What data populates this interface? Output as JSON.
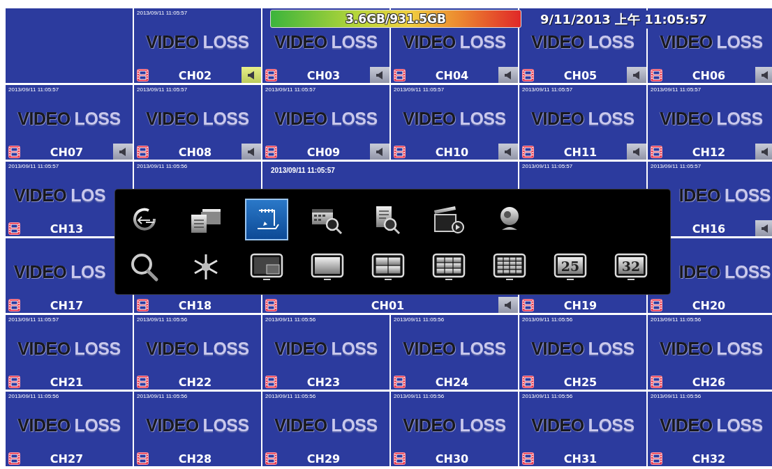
{
  "hdd_usage": {
    "text": "3.6GB/931.5GB"
  },
  "clock": {
    "text": "9/11/2013 上午 11:05:57"
  },
  "cells": [
    {
      "kind": "empty"
    },
    {
      "kind": "channel",
      "timestamp": "2013/09/11 11:05:57",
      "video_loss": [
        "VIDEO",
        "LOSS"
      ],
      "label": "CH02",
      "speaker_highlighted": true
    },
    {
      "kind": "channel",
      "video_loss": [
        "VIDEO",
        "LOSS"
      ],
      "label": "CH03",
      "speaker_highlighted": false
    },
    {
      "kind": "channel",
      "video_loss": [
        "VIDEO",
        "LOSS"
      ],
      "label": "CH04",
      "speaker_highlighted": false
    },
    {
      "kind": "channel",
      "video_loss": [
        "VIDEO",
        "LOSS"
      ],
      "label": "CH05",
      "speaker_highlighted": false
    },
    {
      "kind": "channel",
      "video_loss": [
        "VIDEO",
        "LOSS"
      ],
      "label": "CH06",
      "speaker_highlighted": false
    },
    {
      "kind": "channel",
      "timestamp": "2013/09/11 11:05:57",
      "video_loss": [
        "VIDEO",
        "LOSS"
      ],
      "label": "CH07",
      "speaker_highlighted": false
    },
    {
      "kind": "channel",
      "timestamp": "2013/09/11 11:05:57",
      "video_loss": [
        "VIDEO",
        "LOSS"
      ],
      "label": "CH08",
      "speaker_highlighted": false
    },
    {
      "kind": "channel",
      "timestamp": "2013/09/11 11:05:57",
      "video_loss": [
        "VIDEO",
        "LOSS"
      ],
      "label": "CH09",
      "speaker_highlighted": false
    },
    {
      "kind": "channel",
      "timestamp": "2013/09/11 11:05:57",
      "video_loss": [
        "VIDEO",
        "LOSS"
      ],
      "label": "CH10",
      "speaker_highlighted": false
    },
    {
      "kind": "channel",
      "timestamp": "2013/09/11 11:05:57",
      "video_loss": [
        "VIDEO",
        "LOSS"
      ],
      "label": "CH11",
      "speaker_highlighted": false
    },
    {
      "kind": "channel",
      "timestamp": "2013/09/11 11:05:57",
      "video_loss": [
        "VIDEO",
        "LOSS"
      ],
      "label": "CH12",
      "speaker_highlighted": false
    },
    {
      "kind": "channel",
      "timestamp": "2013/09/11 11:05:57",
      "video_loss": [
        "VIDEO",
        "LOS"
      ],
      "covered_right": true,
      "label": "CH13"
    },
    {
      "kind": "channel",
      "timestamp": "2013/09/11 11:05:56"
    },
    {
      "kind": "main",
      "timestamp": "2013/09/11 11:05:57",
      "label": "CH01",
      "speaker_highlighted": false
    },
    {
      "kind": "channel",
      "timestamp": "2013/09/11 11:05:57"
    },
    {
      "kind": "channel",
      "timestamp": "2013/09/11 11:05:57",
      "video_loss": [
        "IDEO",
        "LOSS"
      ],
      "covered_left": true,
      "label": "CH16",
      "speaker_highlighted": false
    },
    {
      "kind": "channel",
      "video_loss": [
        "VIDEO",
        "LOS"
      ],
      "covered_right": true,
      "label": "CH17"
    },
    {
      "kind": "channel",
      "label": "CH18"
    },
    {
      "kind": "channel",
      "label": "CH19"
    },
    {
      "kind": "channel",
      "video_loss": [
        "IDEO",
        "LOSS"
      ],
      "covered_left": true,
      "label": "CH20"
    },
    {
      "kind": "channel",
      "timestamp": "2013/09/11 11:05:57",
      "video_loss": [
        "VIDEO",
        "LOSS"
      ],
      "label": "CH21"
    },
    {
      "kind": "channel",
      "timestamp": "2013/09/11 11:05:56",
      "video_loss": [
        "VIDEO",
        "LOSS"
      ],
      "label": "CH22"
    },
    {
      "kind": "channel",
      "timestamp": "2013/09/11 11:05:56",
      "video_loss": [
        "VIDEO",
        "LOSS"
      ],
      "label": "CH23"
    },
    {
      "kind": "channel",
      "timestamp": "2013/09/11 11:05:56",
      "video_loss": [
        "VIDEO",
        "LOSS"
      ],
      "label": "CH24"
    },
    {
      "kind": "channel",
      "timestamp": "2013/09/11 11:05:56",
      "video_loss": [
        "VIDEO",
        "LOSS"
      ],
      "label": "CH25"
    },
    {
      "kind": "channel",
      "timestamp": "2013/09/11 11:05:56",
      "video_loss": [
        "VIDEO",
        "LOSS"
      ],
      "label": "CH26"
    },
    {
      "kind": "channel",
      "timestamp": "2013/09/11 11:05:56",
      "video_loss": [
        "VIDEO",
        "LOSS"
      ],
      "label": "CH27"
    },
    {
      "kind": "channel",
      "timestamp": "2013/09/11 11:05:56",
      "video_loss": [
        "VIDEO",
        "LOSS"
      ],
      "label": "CH28"
    },
    {
      "kind": "channel",
      "timestamp": "2013/09/11 11:05:56",
      "video_loss": [
        "VIDEO",
        "LOSS"
      ],
      "label": "CH29"
    },
    {
      "kind": "channel",
      "timestamp": "2013/09/11 11:05:56",
      "video_loss": [
        "VIDEO",
        "LOSS"
      ],
      "label": "CH30"
    },
    {
      "kind": "channel",
      "timestamp": "2013/09/11 11:05:56",
      "video_loss": [
        "VIDEO",
        "LOSS"
      ],
      "label": "CH31"
    },
    {
      "kind": "channel",
      "timestamp": "2013/09/11 11:05:56",
      "video_loss": [
        "VIDEO",
        "LOSS"
      ],
      "label": "CH32"
    }
  ],
  "menu": {
    "rows": [
      [
        {
          "kind": "back",
          "selected": false
        },
        {
          "kind": "folders",
          "selected": false
        },
        {
          "kind": "edit",
          "selected": true
        },
        {
          "kind": "calendar-search",
          "selected": false
        },
        {
          "kind": "document-search",
          "selected": false
        },
        {
          "kind": "clapper",
          "selected": false
        },
        {
          "kind": "webcam",
          "selected": false
        }
      ],
      [
        {
          "kind": "search",
          "selected": false
        },
        {
          "kind": "snowflake",
          "selected": false
        },
        {
          "kind": "pip",
          "selected": false
        },
        {
          "kind": "single",
          "selected": false
        },
        {
          "kind": "quad",
          "selected": false
        },
        {
          "kind": "grid9",
          "selected": false
        },
        {
          "kind": "grid16",
          "selected": false
        },
        {
          "kind": "number",
          "text": "25",
          "selected": false
        },
        {
          "kind": "number",
          "text": "32",
          "selected": false
        }
      ]
    ]
  }
}
